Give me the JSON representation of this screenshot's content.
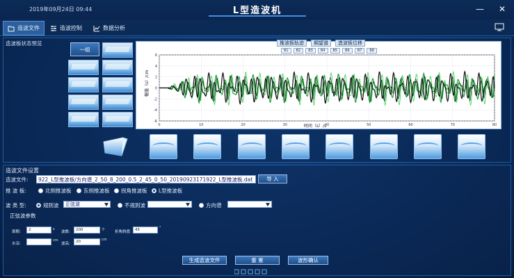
{
  "header": {
    "datetime": "2019年09月24日 09:44",
    "title": "L型造波机",
    "minimize": "—",
    "close": "✕"
  },
  "tabs": [
    {
      "label": "造波文件",
      "active": true
    },
    {
      "label": "造波控制",
      "active": false
    },
    {
      "label": "数据分析",
      "active": false
    }
  ],
  "preview": {
    "title": "造波板状态预览",
    "group_button": "一组",
    "chart_tabs": [
      "推波板轨迹",
      "期望谱",
      "造波板位移"
    ],
    "legend": [
      "B1",
      "B2",
      "B3",
      "B4",
      "B5",
      "B6",
      "B7",
      "B8"
    ]
  },
  "chart_data": {
    "type": "line",
    "ylabel": "幅值（s）/cm",
    "xlabel": "时间（s）/s",
    "x_ticks": [
      "0",
      "10",
      "20",
      "30",
      "40",
      "50",
      "60",
      "70",
      "80"
    ],
    "y_ticks": [
      "6",
      "4",
      "2",
      "0",
      "-2",
      "-4",
      "-6"
    ],
    "xlim": [
      0,
      80
    ],
    "ylim": [
      -6,
      6
    ],
    "series_colors": [
      "#111111",
      "#2bd94a",
      "#1fa43a"
    ]
  },
  "settings": {
    "title": "造波文件设置",
    "file_label": "造波文件:",
    "file_value": "922_L型推波板/方向谱_2_50_8_200_0.5_2_45_0_50_20190923171922_L型推波板.dat",
    "import_button": "导 入",
    "board_label": "推 波 板:",
    "boards": [
      {
        "label": "北侧推波板",
        "checked": false
      },
      {
        "label": "东侧推波板",
        "checked": false
      },
      {
        "label": "拐角推波板",
        "checked": false
      },
      {
        "label": "L型推波板",
        "checked": true
      }
    ],
    "wave_type_label": "波 类 型:",
    "wave_types": [
      {
        "label": "规则波",
        "checked": true,
        "select": "正弦波"
      },
      {
        "label": "不规则波",
        "checked": false,
        "select": ""
      },
      {
        "label": "方向谱",
        "checked": false,
        "select": ""
      }
    ],
    "sine_params_title": "正弦波参数",
    "params": {
      "period_label": "周期:",
      "period_value": "2",
      "period_unit": "s",
      "count_label": "波数:",
      "count_value": "200",
      "count_unit": "个",
      "angle_label": "折角斜度:",
      "angle_value": "45",
      "angle_unit": "°",
      "depth_label": "水深:",
      "depth_value": "",
      "depth_unit": "cm",
      "height_label": "波高:",
      "height_value": "20",
      "height_unit": "cm"
    },
    "buttons": [
      "生成造波文件",
      "重 置",
      "波形确认"
    ]
  }
}
